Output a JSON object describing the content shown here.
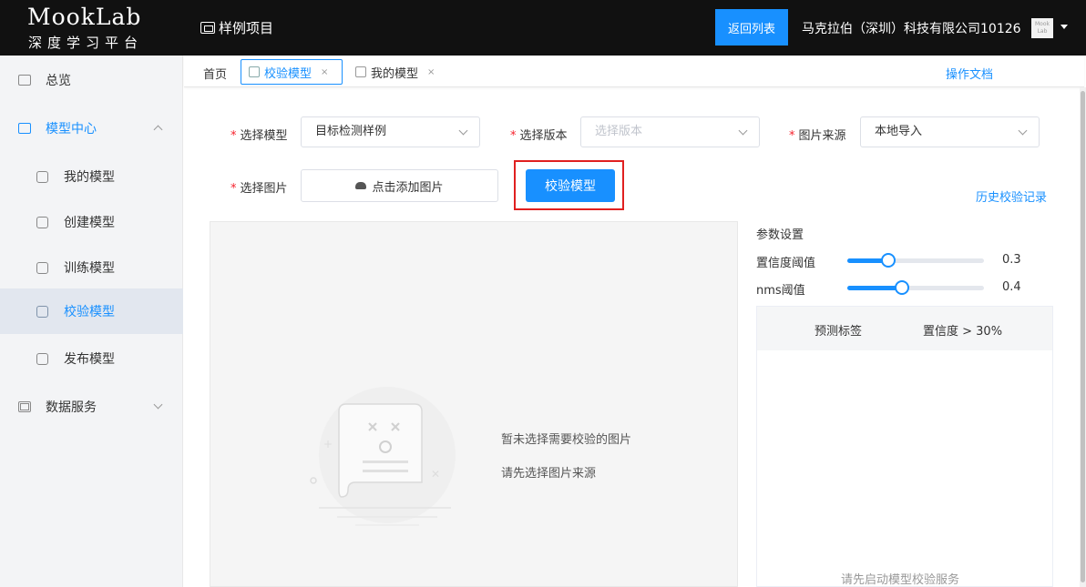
{
  "header": {
    "logo_title": "MookLab",
    "logo_subtitle": "深度学习平台",
    "project_name": "样例项目",
    "back_button": "返回列表",
    "company": "马克拉伯（深圳）科技有限公司10126",
    "avatar_text": "Mook Lab"
  },
  "sidebar": {
    "overview": "总览",
    "model_center": "模型中心",
    "my_models": "我的模型",
    "create_model": "创建模型",
    "train_model": "训练模型",
    "verify_model": "校验模型",
    "publish_model": "发布模型",
    "data_service": "数据服务"
  },
  "tabs": {
    "home": "首页",
    "verify_model": "校验模型",
    "my_models": "我的模型",
    "close": "×",
    "docs_link": "操作文档"
  },
  "form": {
    "select_model_label": "选择模型",
    "select_model_value": "目标检测样例",
    "select_version_label": "选择版本",
    "select_version_placeholder": "选择版本",
    "image_source_label": "图片来源",
    "image_source_value": "本地导入",
    "select_image_label": "选择图片",
    "upload_button": "点击添加图片",
    "verify_button": "校验模型",
    "history_link": "历史校验记录",
    "required_mark": "*"
  },
  "preview": {
    "empty_line1": "暂未选择需要校验的图片",
    "empty_line2": "请先选择图片来源"
  },
  "params": {
    "title": "参数设置",
    "confidence_label": "置信度阈值",
    "confidence_value": "0.3",
    "confidence_fraction": 0.3,
    "nms_label": "nms阈值",
    "nms_value": "0.4",
    "nms_fraction": 0.4
  },
  "results": {
    "col_label": "预测标签",
    "col_confidence": "置信度 > 30%",
    "empty_message": "请先启动模型校验服务"
  },
  "colors": {
    "accent": "#1890ff",
    "header_bg": "#111111",
    "highlight": "#e02020",
    "required": "#f5222d"
  }
}
